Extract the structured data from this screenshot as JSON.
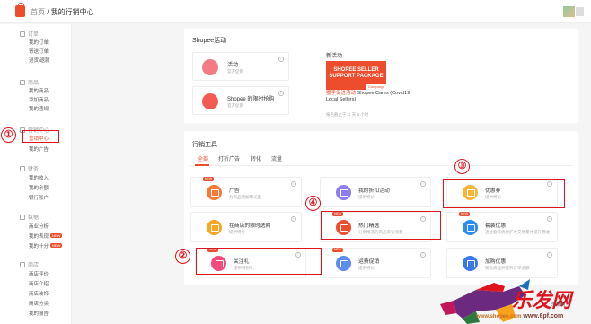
{
  "header": {
    "home": "首页",
    "separator": " / ",
    "current": "我的行销中心"
  },
  "sidebar": {
    "sections": [
      {
        "label": "订单",
        "items": [
          "我的订单",
          "寄送订单",
          "退货/退款"
        ]
      },
      {
        "label": "商品",
        "items": [
          "我的商品",
          "添加商品",
          "我的违规"
        ]
      },
      {
        "label": "营销中心",
        "items": [
          "营销中心",
          "我的广告"
        ]
      },
      {
        "label": "财务",
        "items": [
          "我的收入",
          "我的余额",
          "银行账户"
        ]
      },
      {
        "label": "数据",
        "items": [
          "商业分析",
          "我的表现",
          "我的计分"
        ]
      },
      {
        "label": "商店",
        "items": [
          "商店评价",
          "商店介绍",
          "商店装饰",
          "商店分类",
          "我的报告"
        ]
      }
    ],
    "new_badge": "NEW"
  },
  "shopee_activity": {
    "title": "Shopee活动",
    "items": [
      {
        "name": "活动",
        "sub": "官方促销"
      },
      {
        "name": "Shopee 的限时抢购",
        "sub": "官方促销"
      }
    ],
    "new_activity": {
      "label": "新活动",
      "banner_line1": "SHOPEE SELLER",
      "banner_line2": "SUPPORT PACKAGE",
      "banner_tag": "Campaign",
      "link": "援手促进活动",
      "desc": "Shopee Cares (Covid19 Local Sellers)",
      "meta": "报名截止于: 1 天 5 小时"
    }
  },
  "marketing_tools": {
    "title": "行销工具",
    "tabs": [
      "全部",
      "打折广告",
      "转化",
      "流量"
    ],
    "new_badge": "NEW",
    "tools": [
      {
        "name": "广告",
        "sub": "为商品增加曝光度",
        "color": "#f5793a"
      },
      {
        "name": "我的折扣活动",
        "sub": "提供特价",
        "color": "#8e7cf0"
      },
      {
        "name": "优惠券",
        "sub": "提供特价",
        "color": "#f5b63a"
      },
      {
        "name": "在商店的限时选购",
        "sub": "提供特价",
        "color": "#f5a623"
      },
      {
        "name": "热门精选",
        "sub": "分享精选的商品来访流量",
        "color": "#ee4d2d"
      },
      {
        "name": "套装优惠",
        "sub": "通过套装优惠扩大交易量并提升营收",
        "color": "#2d8cf0"
      },
      {
        "name": "关注礼",
        "sub": "提供特别礼",
        "color": "#f04b7b"
      },
      {
        "name": "运费促销",
        "sub": "提供特价",
        "color": "#5b8def"
      },
      {
        "name": "加购优惠",
        "sub": "销售商品并提升订单总额",
        "color": "#3a78e8"
      }
    ]
  },
  "annotations": [
    "①",
    "②",
    "③",
    "④"
  ],
  "watermark": {
    "brand": "乐发网",
    "sub": "乐发网",
    "url": "www.6pf.com",
    "url_left": "www.shopee.com"
  }
}
